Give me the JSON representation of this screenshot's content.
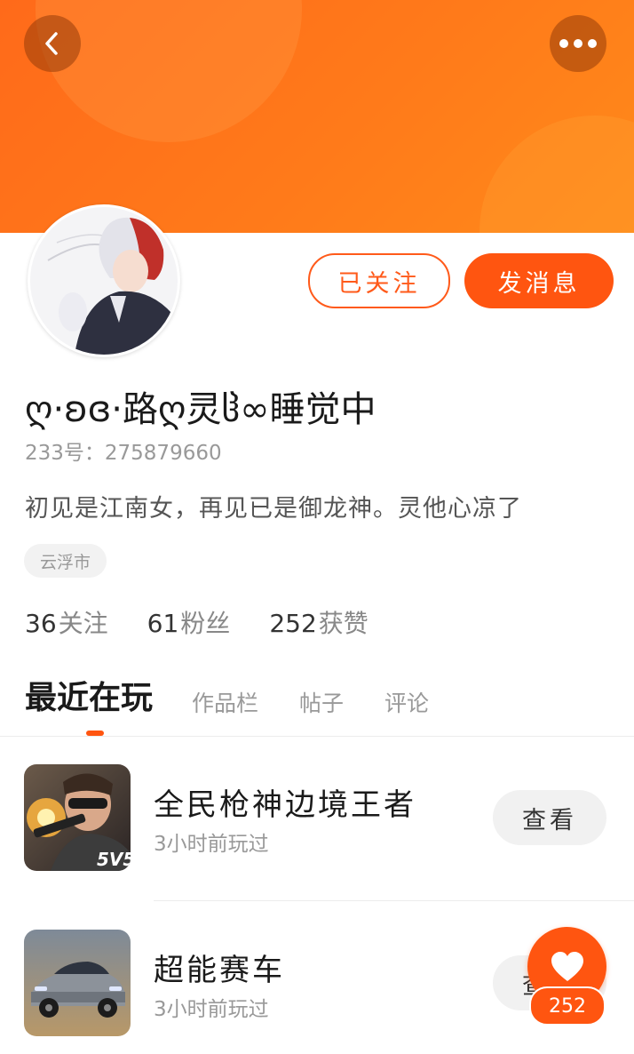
{
  "header": {
    "back_icon": "chevron-left-icon",
    "more_icon": "more-dots-icon",
    "colors": {
      "banner_start": "#ff6a1a",
      "banner_end": "#ff8a1a",
      "accent": "#ff5510"
    }
  },
  "profile": {
    "username": "ღ·ʚɞ·路ღ灵ჱ∞睡觉中",
    "id_label": "233号：275879660",
    "bio": "初见是江南女，再见已是御龙神。灵他心凉了",
    "location": "云浮市",
    "followed_label": "已关注",
    "message_label": "发消息"
  },
  "stats": [
    {
      "value": "36",
      "label": "关注"
    },
    {
      "value": "61",
      "label": "粉丝"
    },
    {
      "value": "252",
      "label": "获赞"
    }
  ],
  "tabs": [
    {
      "label": "最近在玩",
      "active": true
    },
    {
      "label": "作品栏"
    },
    {
      "label": "帖子"
    },
    {
      "label": "评论"
    }
  ],
  "games": [
    {
      "title": "全民枪神边境王者",
      "subtitle": "3小时前玩过",
      "action": "查看",
      "icon": "shooter-game-icon"
    },
    {
      "title": "超能赛车",
      "subtitle": "3小时前玩过",
      "action": "查看",
      "icon": "racing-car-game-icon"
    }
  ],
  "like": {
    "count": "252",
    "icon": "heart-icon"
  }
}
